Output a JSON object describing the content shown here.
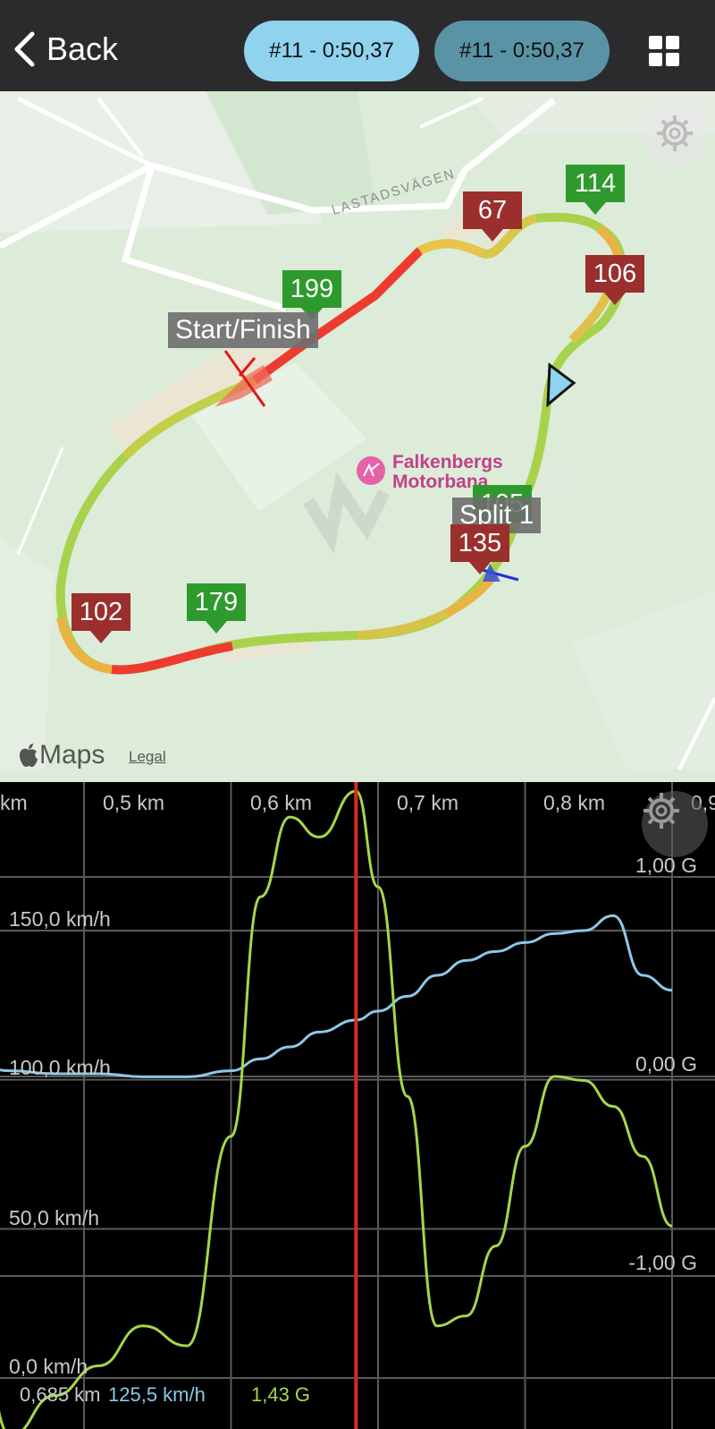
{
  "header": {
    "back_label": "Back",
    "lap_buttons": [
      "#11 - 0:50,37",
      "#11 - 0:50,37"
    ],
    "colors": {
      "lap_primary": "#8fd3ef",
      "lap_secondary": "#5a93a6"
    },
    "grid_icon": "grid-icon"
  },
  "map": {
    "road_label": "LASTADSVÄGEN",
    "poi": {
      "line1": "Falkenbergs",
      "line2": "Motorbana"
    },
    "labels": {
      "start_finish": "Start/Finish",
      "split_1": "Split 1"
    },
    "markers": [
      {
        "value": "199",
        "kind": "max"
      },
      {
        "value": "67",
        "kind": "min"
      },
      {
        "value": "114",
        "kind": "max"
      },
      {
        "value": "106",
        "kind": "min"
      },
      {
        "value": "105",
        "kind": "max"
      },
      {
        "value": "135",
        "kind": "min"
      },
      {
        "value": "179",
        "kind": "max"
      },
      {
        "value": "102",
        "kind": "min"
      }
    ],
    "attribution": "Maps",
    "legal": "Legal",
    "settings_icon": "gear-icon"
  },
  "chart": {
    "x_ticks": [
      "km",
      "0,5 km",
      "0,6 km",
      "0,7 km",
      "0,8 km",
      "0,9"
    ],
    "speed_ticks": [
      "150,0 km/h",
      "100,0 km/h",
      "50,0 km/h",
      "0,0 km/h"
    ],
    "g_ticks": [
      "1,00 G",
      "0,00 G",
      "-1,00 G"
    ],
    "readout": {
      "distance": "0,685 km",
      "speed": "125,5 km/h",
      "g": "1,43 G"
    },
    "colors": {
      "speed": "#8cc8e6",
      "g": "#a6d64a",
      "cursor": "#d62b22",
      "grid": "#5a5a5a"
    }
  },
  "chart_data": {
    "type": "line",
    "x": [
      0.42,
      0.45,
      0.48,
      0.51,
      0.54,
      0.57,
      0.6,
      0.62,
      0.64,
      0.66,
      0.685,
      0.7,
      0.72,
      0.74,
      0.76,
      0.78,
      0.8,
      0.82,
      0.84,
      0.86,
      0.88,
      0.9
    ],
    "series": [
      {
        "axis": "speed",
        "unit": "km/h",
        "values": [
          106,
          103,
          102,
          102,
          101,
          101,
          103,
          107,
          111,
          116,
          120,
          123,
          128,
          135,
          140,
          143,
          146,
          149,
          150,
          155,
          135,
          130
        ]
      },
      {
        "axis": "g",
        "unit": "G",
        "values": [
          -0.8,
          -1.8,
          -1.6,
          -1.45,
          -1.25,
          -1.35,
          -0.3,
          0.9,
          1.3,
          1.2,
          1.43,
          0.95,
          -0.1,
          -1.25,
          -1.2,
          -0.85,
          -0.35,
          0.0,
          -0.02,
          -0.15,
          -0.4,
          -0.75
        ]
      }
    ],
    "speed_ylim": [
      0,
      150
    ],
    "g_ylim": [
      -1,
      1
    ],
    "cursor_x": 0.685,
    "grid": true
  }
}
